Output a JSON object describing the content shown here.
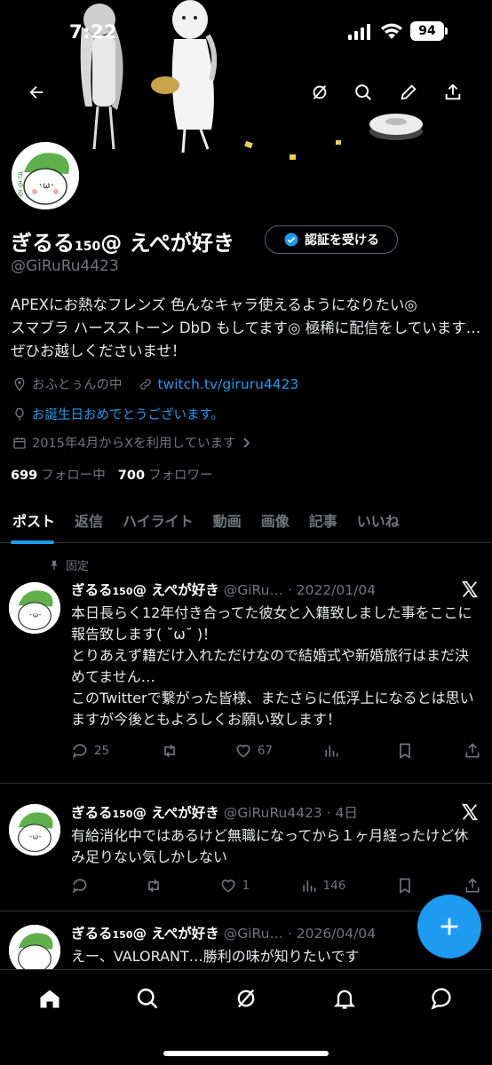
{
  "status_bar": {
    "time": "7:22",
    "battery": "94"
  },
  "header": {
    "icons": [
      "back-arrow-icon",
      "grok-icon",
      "search-icon",
      "edit-icon",
      "share-icon"
    ]
  },
  "profile": {
    "name_main": "ぎるる",
    "name_sub": "150",
    "name_rest": "@ えぺが好き",
    "verify_label": "認証を受ける",
    "handle": "@GiRuRu4423",
    "bio": "APEXにお熱なフレンズ 色んなキャラ使えるようになりたい◎\nスマブラ ハースストーン DbD もしてます◎ 極稀に配信をしています…ぜひお越しくださいませ！",
    "location": "おふとぅんの中",
    "link": "twitch.tv/giruru4423",
    "birthday": "お誕生日おめでとうございます。",
    "joined": "2015年4月からXを利用しています",
    "following_count": "699",
    "following_label": "フォロー中",
    "followers_count": "700",
    "followers_label": "フォロワー"
  },
  "tabs": [
    {
      "label": "ポスト",
      "active": true
    },
    {
      "label": "返信",
      "active": false
    },
    {
      "label": "ハイライト",
      "active": false
    },
    {
      "label": "動画",
      "active": false
    },
    {
      "label": "画像",
      "active": false
    },
    {
      "label": "記事",
      "active": false
    },
    {
      "label": "いいね",
      "active": false
    }
  ],
  "posts": [
    {
      "pinned_label": "固定",
      "name_main": "ぎるる",
      "name_sub": "150",
      "name_rest": "@ えぺが好き",
      "handle_time": "@GiRu… · 2022/01/04",
      "text": "本日長らく12年付き合ってた彼女と入籍致しました事をここに報告致します( ˘ω˘ )！\nとりあえず籍だけ入れただけなので結婚式や新婚旅行はまだ決めてません…\nこのTwitterで繋がった皆様、またさらに低浮上になるとは思いますが今後ともよろしくお願い致します！",
      "replies": "25",
      "reposts": "",
      "likes": "67",
      "views": ""
    },
    {
      "pinned_label": "",
      "name_main": "ぎるる",
      "name_sub": "150",
      "name_rest": "@ えぺが好き",
      "handle_time": "@GiRuRu4423 · 4日",
      "text": "有給消化中ではあるけど無職になってから１ヶ月経ったけど休み足りない気しかしない",
      "replies": "",
      "reposts": "",
      "likes": "1",
      "views": "146"
    },
    {
      "pinned_label": "",
      "name_main": "ぎるる",
      "name_sub": "150",
      "name_rest": "@ えぺが好き",
      "handle_time": "@GiRu… · 2026/04/04",
      "text": "えー、VALORANT…勝利の味が知りたいです",
      "replies": "",
      "reposts": "",
      "likes": "",
      "views": ""
    }
  ],
  "bottom_nav": {
    "icons": [
      "home-icon",
      "search-icon",
      "grok-icon",
      "notifications-icon",
      "messages-icon"
    ]
  },
  "colors": {
    "accent": "#1d9bf0",
    "background": "#000000",
    "muted": "#71767b"
  }
}
